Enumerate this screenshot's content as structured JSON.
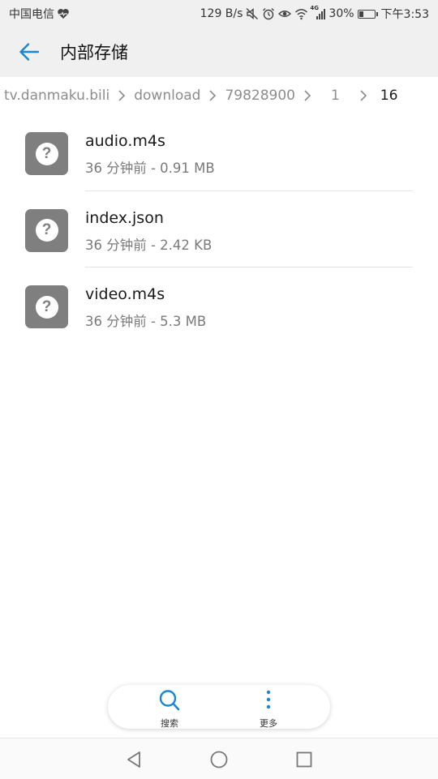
{
  "status_bar": {
    "carrier": "中国电信",
    "net_speed": "129 B/s",
    "network_type": "4G",
    "battery_percent": "30%",
    "time": "下午3:53",
    "battery_level": 0.3,
    "icons": [
      "heart-pulse-icon",
      "mute-icon",
      "alarm-icon",
      "eye-icon",
      "wifi-icon",
      "signal-icon",
      "battery-icon"
    ]
  },
  "app_bar": {
    "title": "内部存储"
  },
  "breadcrumb": {
    "items": [
      "tv.danmaku.bili",
      "download",
      "79828900",
      "1",
      "16"
    ]
  },
  "files": [
    {
      "name": "audio.m4s",
      "meta": "36 分钟前 - 0.91 MB",
      "icon": "unknown-file-icon"
    },
    {
      "name": "index.json",
      "meta": "36 分钟前 - 2.42 KB",
      "icon": "unknown-file-icon"
    },
    {
      "name": "video.m4s",
      "meta": "36 分钟前 - 5.3 MB",
      "icon": "unknown-file-icon"
    }
  ],
  "toolbar": {
    "search_label": "搜索",
    "more_label": "更多"
  },
  "colors": {
    "accent": "#1a86d6",
    "file_icon_bg": "#7f7f7f",
    "bar_bg": "#f0f0f0"
  }
}
